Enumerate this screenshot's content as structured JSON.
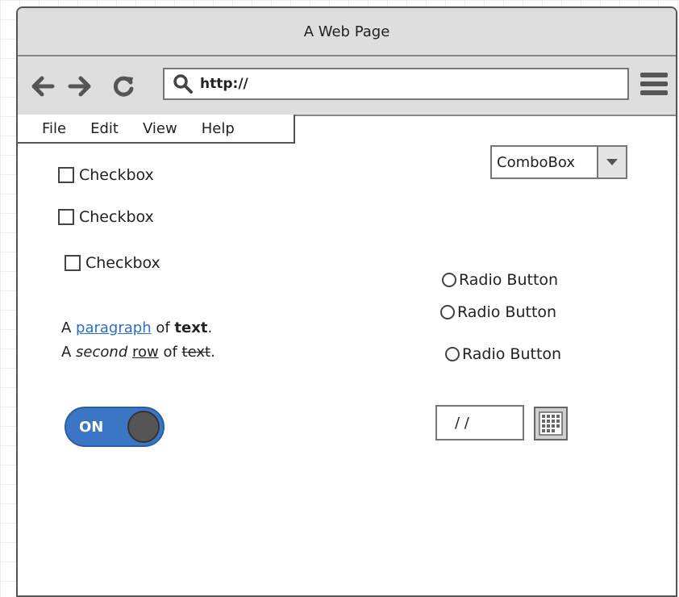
{
  "window": {
    "title": "A Web Page"
  },
  "toolbar": {
    "back_icon": "arrow-left-icon",
    "forward_icon": "arrow-right-icon",
    "reload_icon": "reload-icon",
    "url_value": "http://",
    "search_icon": "search-icon",
    "menu_icon": "hamburger-menu-icon"
  },
  "menubar": {
    "items": [
      "File",
      "Edit",
      "View",
      "Help"
    ]
  },
  "checkboxes": [
    {
      "label": "Checkbox",
      "checked": false
    },
    {
      "label": "Checkbox",
      "checked": false
    },
    {
      "label": "Checkbox",
      "checked": false
    }
  ],
  "combobox": {
    "value": "ComboBox"
  },
  "radios": [
    {
      "label": "Radio Button",
      "selected": false
    },
    {
      "label": "Radio Button",
      "selected": false
    },
    {
      "label": "Radio Button",
      "selected": false
    }
  ],
  "paragraph": {
    "line1": {
      "a": "A ",
      "link": "paragraph",
      "of": " of ",
      "bold": "text",
      "end": "."
    },
    "line2": {
      "a": "A ",
      "italic": "second",
      "sp": " ",
      "underline": "row",
      "of": " of ",
      "strike": "text",
      "end": "."
    }
  },
  "toggle": {
    "label": "ON",
    "on": true
  },
  "date": {
    "value": "/ /"
  },
  "colors": {
    "accent": "#3a76c4",
    "chrome": "#dedede",
    "link": "#2e6fc0"
  }
}
